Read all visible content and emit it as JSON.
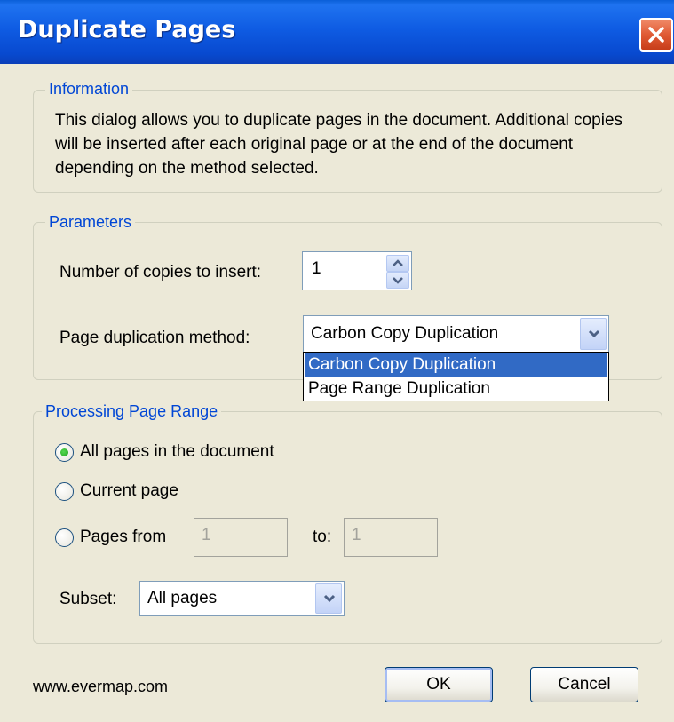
{
  "window": {
    "title": "Duplicate Pages"
  },
  "information": {
    "group_label": "Information",
    "text": "This dialog allows you to duplicate pages in the document. Additional copies will be inserted after each original page or at the end of the document depending on the method selected."
  },
  "parameters": {
    "group_label": "Parameters",
    "copies_label": "Number of copies to insert:",
    "copies_value": "1",
    "method_label": "Page duplication method:",
    "method_value": "Carbon Copy Duplication",
    "method_options": [
      "Carbon Copy Duplication",
      "Page Range Duplication"
    ]
  },
  "range": {
    "group_label": "Processing Page Range",
    "all_pages_label": "All pages in the document",
    "current_page_label": "Current page",
    "pages_from_label": "Pages from",
    "from_value": "1",
    "to_label": "to:",
    "to_value": "1",
    "subset_label": "Subset:",
    "subset_value": "All pages",
    "selected_option": "All pages in the document"
  },
  "footer": {
    "website": "www.evermap.com",
    "ok_label": "OK",
    "cancel_label": "Cancel"
  },
  "icons": [
    "close-icon",
    "spin-up-icon",
    "spin-down-icon",
    "chevron-down-icon",
    "radio-selected-icon"
  ],
  "colors": {
    "titlebar": "#0a5fd8",
    "dialog_bg": "#ece9d8",
    "group_label": "#0046d5",
    "selection": "#316ac5",
    "close_button": "#e05a34"
  }
}
